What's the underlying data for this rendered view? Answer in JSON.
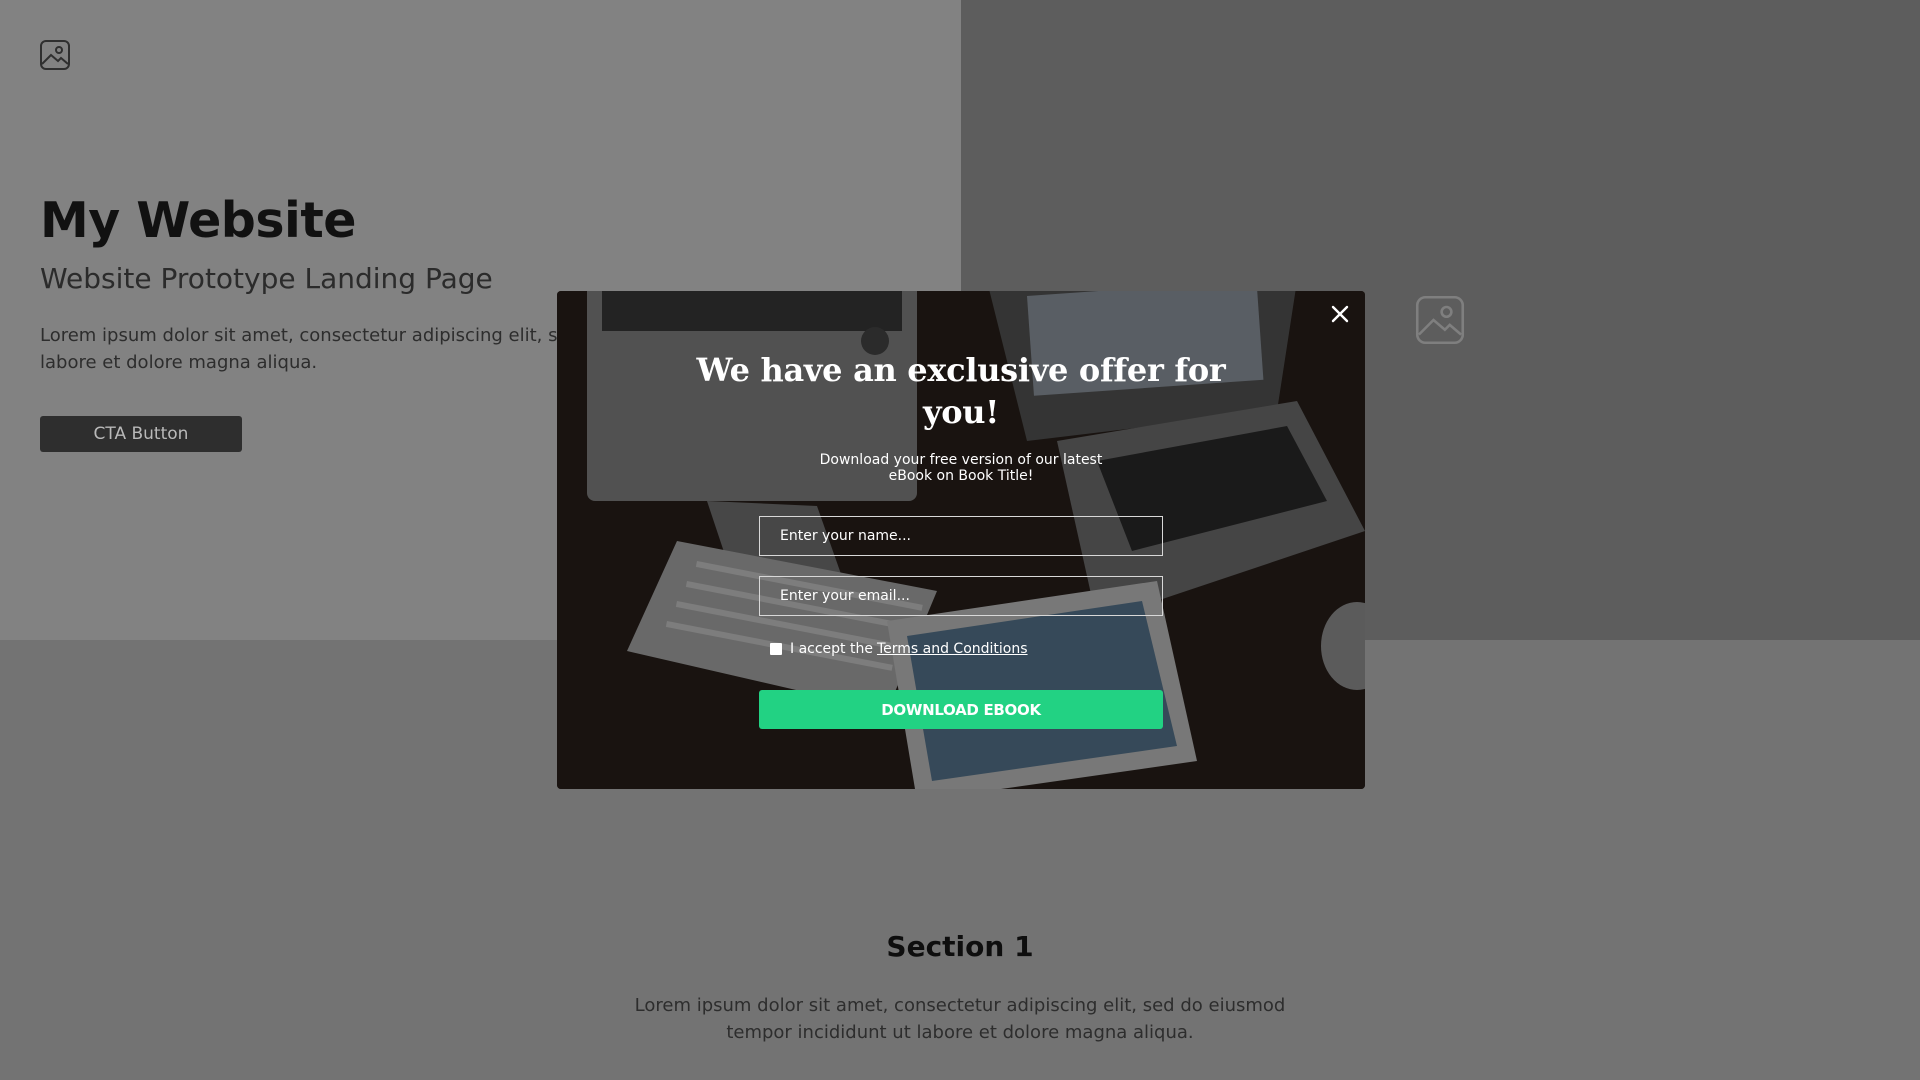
{
  "page": {
    "icons": {
      "logo": "image-icon",
      "hero_image": "image-icon"
    },
    "hero": {
      "title": "My Website",
      "subtitle": "Website Prototype Landing Page",
      "body": "Lorem ipsum dolor sit amet, consectetur adipiscing elit, s\nlabore et dolore magna aliqua.",
      "cta_label": "CTA Button"
    },
    "section1": {
      "title": "Section 1",
      "body": "Lorem ipsum dolor sit amet, consectetur adipiscing elit, sed do eiusmod\ntempor incididunt ut labore et dolore magna aliqua."
    }
  },
  "modal": {
    "close_icon": "close-icon",
    "title": "We have an exclusive offer for you!",
    "description": "Download your free version of our latest\neBook on Book Title!",
    "name_placeholder": "Enter your name...",
    "email_placeholder": "Enter your email...",
    "terms_prefix": "I accept the",
    "terms_link": "Terms and Conditions",
    "submit_label": "DOWNLOAD EBOOK"
  },
  "colors": {
    "accent_green": "#22d283",
    "hero_left_bg": "#828282",
    "hero_right_bg": "#5d5d5d",
    "lower_bg": "#737373",
    "cta_bg": "#2e2e2e"
  }
}
